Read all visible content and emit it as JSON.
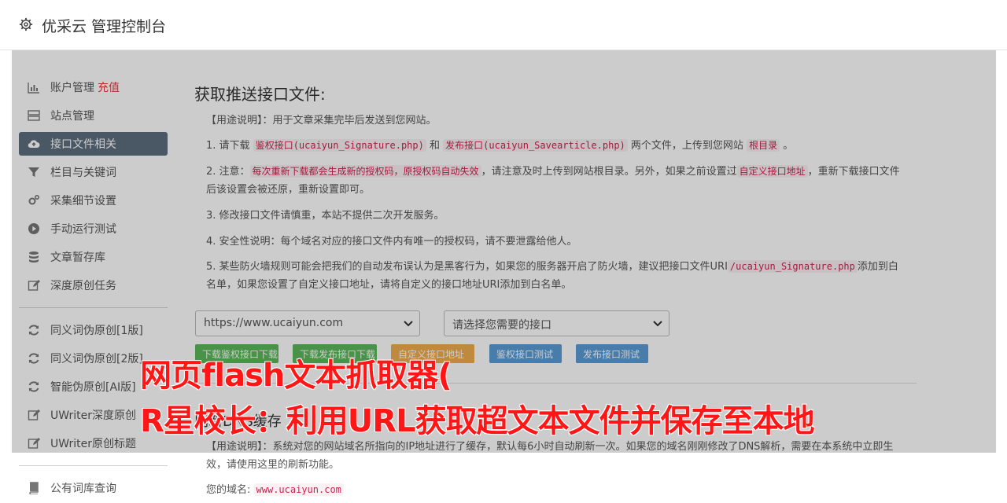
{
  "app": {
    "title": "优采云 管理控制台"
  },
  "sidebar": {
    "items": [
      {
        "label": "账户管理",
        "extra": "充值",
        "icon": "bar-chart-icon"
      },
      {
        "label": "站点管理",
        "icon": "server-icon"
      },
      {
        "label": "接口文件相关",
        "icon": "cloud-upload-icon",
        "active": true
      },
      {
        "label": "栏目与关键词",
        "icon": "filter-icon"
      },
      {
        "label": "采集细节设置",
        "icon": "cogs-icon"
      },
      {
        "label": "手动运行测试",
        "icon": "play-circle-icon"
      },
      {
        "label": "文章暂存库",
        "icon": "database-icon"
      },
      {
        "label": "深度原创任务",
        "icon": "edit-icon"
      }
    ],
    "items2": [
      {
        "label": "同义词伪原创[1版]",
        "icon": "refresh-icon"
      },
      {
        "label": "同义词伪原创[2版]",
        "icon": "refresh-icon"
      },
      {
        "label": "智能伪原创[AI版]",
        "icon": "refresh-icon"
      },
      {
        "label": "UWriter深度原创",
        "icon": "edit-icon"
      },
      {
        "label": "UWriter原创标题",
        "icon": "edit-icon"
      }
    ],
    "items3": [
      {
        "label": "公有词库查询",
        "icon": "book-icon"
      }
    ]
  },
  "main": {
    "heading": "获取推送接口文件:",
    "usage": "【用途说明】：用于文章采集完毕后发送到您网站。",
    "step1": {
      "a": "1. 请下载",
      "code1": "鉴权接口(ucaiyun_Signature.php)",
      "b": "和",
      "code2": "发布接口(ucaiyun_Savearticle.php)",
      "c": "两个文件，上传到您网站",
      "code3": "根目录",
      "d": "。"
    },
    "step2": {
      "a": "2. 注意：",
      "code1": "每次重新下载都会生成新的授权码，原授权码自动失效",
      "b": "，请注意及时上传到网站根目录。另外，如果之前设置过",
      "code2": "自定义接口地址",
      "c": "，重新下载接口文件后该设置会被还原，重新设置即可。"
    },
    "step3": "3. 修改接口文件请慎重，本站不提供二次开发服务。",
    "step4": "4. 安全性说明：每个域名对应的接口文件内有唯一的授权码，请不要泄露给他人。",
    "step5": {
      "a": "5. 某些防火墙规则可能会把我们的自动发布误认为是黑客行为，如果您的服务器开启了防火墙，建议把接口文件URI",
      "code1": "/ucaiyun_Signature.php",
      "b": "添加到白名单，如果您设置了自定义接口地址，请将自定义的接口地址URI添加到白名单。"
    },
    "site_select": "https://www.ucaiyun.com",
    "api_select": "请选择您需要的接口",
    "buttons": {
      "download_sign": "下载鉴权接口下载",
      "download_publish": "下载发布接口下载",
      "custom_url": "自定义接口地址",
      "test_sign": "鉴权接口测试",
      "test_publish": "发布接口测试"
    },
    "cache_heading": "刷新DNS缓存",
    "cache_usage": "【用途说明】：系统对您的网站域名所指向的IP地址进行了缓存，默认每6小时自动刷新一次。如果您的域名刚刚修改了DNS解析，需要在本系统中立即生效，请使用这里的刷新功能。",
    "domain_label": "您的域名:",
    "domain_value": "www.ucaiyun.com"
  },
  "overlay": {
    "line1": "网页flash文本抓取器(",
    "line2": "R星校长：利用URL获取超文本文件并保存至本地"
  },
  "colors": {
    "btn_green": "#5cb85c",
    "btn_orange": "#f0ad4e",
    "btn_blue": "#5b9bd5",
    "active_nav": "#5d6d7e",
    "watermark": "#ff1616"
  }
}
